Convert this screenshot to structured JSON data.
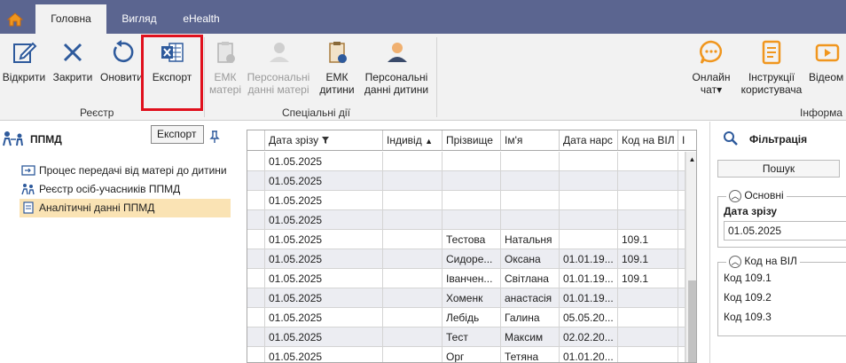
{
  "tabs": [
    "Головна",
    "Вигляд",
    "eHealth"
  ],
  "ribbon": {
    "registry": {
      "label": "Реєстр",
      "buttons": [
        "Відкрити",
        "Закрити",
        "Оновити",
        "Експорт"
      ]
    },
    "special": {
      "label": "Спеціальні дії",
      "buttons": [
        {
          "line1": "ЕМК",
          "line2": "матері"
        },
        {
          "line1": "Персональні",
          "line2": "данні матері"
        },
        {
          "line1": "ЕМК",
          "line2": "дитини"
        },
        {
          "line1": "Персональні",
          "line2": "данні дитини"
        }
      ]
    },
    "info": {
      "label": "Інформа",
      "buttons": [
        {
          "line1": "Онлайн",
          "line2": "чат▾"
        },
        {
          "line1": "Інструкції",
          "line2": "користувача"
        },
        {
          "line1": "Відеом",
          "line2": ""
        }
      ]
    }
  },
  "tooltip": "Експорт",
  "left_panel": {
    "title": "ППМД",
    "items": [
      "Процес передачі від матері до дитини",
      "Реєстр осіб-учасників ППМД",
      "Аналітичні данні ППМД"
    ],
    "selected_index": 2
  },
  "grid": {
    "columns": [
      "Дата зрізу",
      "Індивід",
      "Прізвище",
      "Ім'я",
      "Дата нарс",
      "Код на ВІЛ",
      "І"
    ],
    "rows": [
      [
        "01.05.2025",
        "",
        "",
        "",
        "",
        "",
        ""
      ],
      [
        "01.05.2025",
        "",
        "",
        "",
        "",
        "",
        ""
      ],
      [
        "01.05.2025",
        "",
        "",
        "",
        "",
        "",
        ""
      ],
      [
        "01.05.2025",
        "",
        "",
        "",
        "",
        "",
        ""
      ],
      [
        "01.05.2025",
        "",
        "Тестова",
        "Натальня",
        "",
        "109.1",
        ""
      ],
      [
        "01.05.2025",
        "",
        "Сидоре...",
        "Оксана",
        "01.01.19...",
        "109.1",
        ""
      ],
      [
        "01.05.2025",
        "",
        "Іванчен...",
        "Світлана",
        "01.01.19...",
        "109.1",
        ""
      ],
      [
        "01.05.2025",
        "",
        "Хоменк",
        "анастасія",
        "01.01.19...",
        "",
        ""
      ],
      [
        "01.05.2025",
        "",
        "Лебідь",
        "Галина",
        "05.05.20...",
        "",
        ""
      ],
      [
        "01.05.2025",
        "",
        "Тест",
        "Максим",
        "02.02.20...",
        "",
        ""
      ],
      [
        "01.05.2025",
        "",
        "Орг",
        "Тетяна",
        "01.01.20...",
        "",
        ""
      ]
    ]
  },
  "filter": {
    "title": "Фільтрація",
    "search_button": "Пошук",
    "main_section": "Основні",
    "date_label": "Дата зрізу",
    "date_value": "01.05.2025",
    "hiv_section": "Код на ВІЛ",
    "hiv_codes": [
      "Код 109.1",
      "Код 109.2",
      "Код 109.3"
    ]
  },
  "colors": {
    "tab_bar": "#5b6590",
    "ribbon_bg": "#f2f2f2",
    "highlight": "#e0101d",
    "selected_item": "#fae3b4",
    "row_alt": "#ecedf2",
    "accent_blue": "#2e5a9c",
    "accent_orange": "#f0961e"
  }
}
